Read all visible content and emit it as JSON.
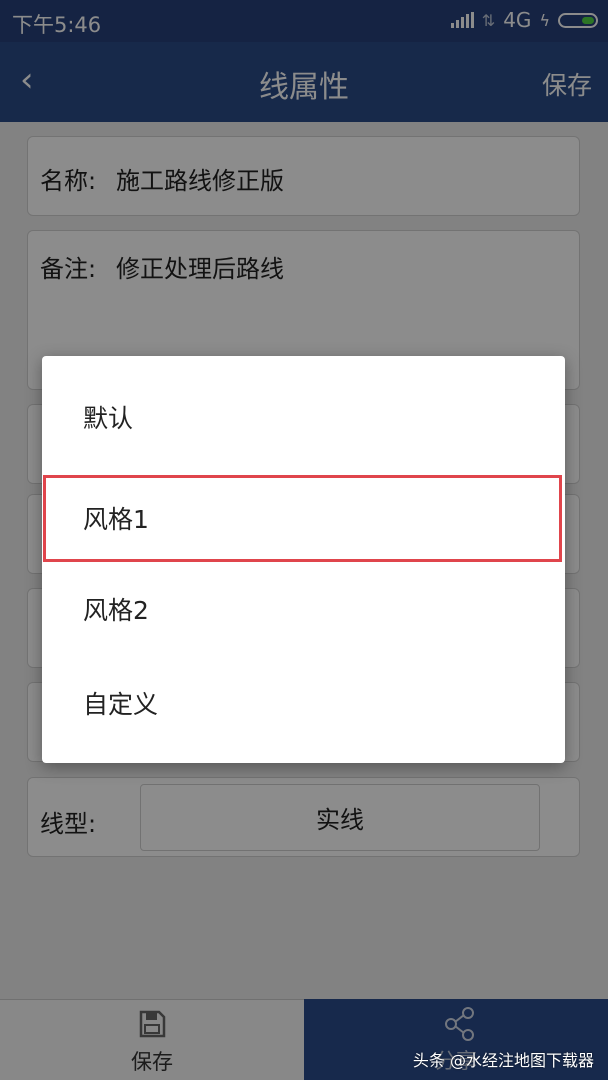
{
  "status": {
    "time": "下午5:46",
    "network": "4G"
  },
  "header": {
    "back": "‹",
    "title": "线属性",
    "save": "保存"
  },
  "form": {
    "name_label": "名称:",
    "name_value": "施工路线修正版",
    "note_label": "备注:",
    "note_value": "修正处理后路线",
    "linetype_label": "线型:",
    "linetype_value": "实线"
  },
  "bottom": {
    "save_label": "保存",
    "share_label": "分享"
  },
  "dialog": {
    "options": [
      "默认",
      "风格1",
      "风格2",
      "自定义"
    ],
    "selected_index": 1
  },
  "watermark": "头条 @水经注地图下载器",
  "colors": {
    "header": "#2a4b88",
    "statusbar": "#27417a",
    "highlight": "#e0454c"
  }
}
